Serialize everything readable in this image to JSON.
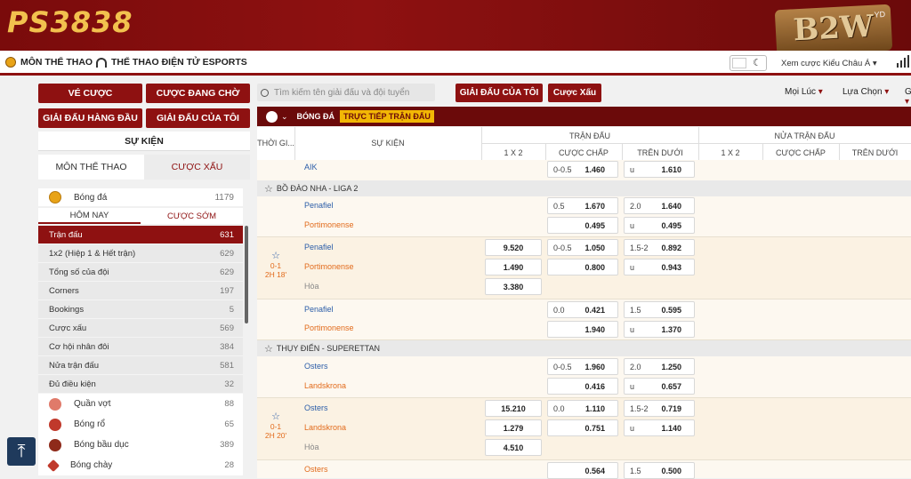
{
  "header": {
    "logo_main": "PS",
    "logo_num": "3838",
    "brand_logo": "B2W",
    "brand_sub": "YD"
  },
  "nav": {
    "sports": "MÔN THỂ THAO",
    "esports": "THỂ THAO ĐIỆN TỬ ESPORTS",
    "odds_format": "Xem cược Kiểu Châu Á",
    "icons": {
      "sports": "soccer-ball-icon",
      "esports": "headset-icon",
      "theme": "moon-icon",
      "signal": "signal-icon"
    }
  },
  "sidebar": {
    "buttons": [
      "VÉ CƯỢC",
      "CƯỢC ĐANG CHỜ",
      "GIẢI ĐẤU HÀNG ĐẦU",
      "GIẢI ĐẤU CỦA TÔI"
    ],
    "events_label": "SỰ KIỆN",
    "tabs": [
      "MÔN THỂ THAO",
      "CƯỢC XẤU"
    ],
    "main_sport": {
      "name": "Bóng đá",
      "count": "1179"
    },
    "subtabs": [
      "HÔM NAY",
      "CƯỢC SỚM"
    ],
    "categories": [
      {
        "label": "Trận đấu",
        "count": "631"
      },
      {
        "label": "1x2 (Hiệp 1 & Hết trận)",
        "count": "629"
      },
      {
        "label": "Tổng số của đội",
        "count": "629"
      },
      {
        "label": "Corners",
        "count": "197"
      },
      {
        "label": "Bookings",
        "count": "5"
      },
      {
        "label": "Cược xấu",
        "count": "569"
      },
      {
        "label": "Cơ hội nhân đôi",
        "count": "384"
      },
      {
        "label": "Nửa trận đấu",
        "count": "581"
      },
      {
        "label": "Đủ điều kiện",
        "count": "32"
      }
    ],
    "sports": [
      {
        "name": "Quần vợt",
        "count": "88",
        "icon": "tennis-icon",
        "color": "#e07a6a"
      },
      {
        "name": "Bóng rổ",
        "count": "65",
        "icon": "basketball-icon",
        "color": "#c0392b"
      },
      {
        "name": "Bóng bầu dục",
        "count": "389",
        "icon": "football-icon",
        "color": "#8e2a1a"
      },
      {
        "name": "Bóng chày",
        "count": "28",
        "icon": "baseball-icon",
        "color": "#c0392b"
      }
    ]
  },
  "toolbar": {
    "search_placeholder": "Tìm kiếm tên giải đấu và đội tuyển",
    "my_leagues": "GIẢI ĐẤU CỦA TÔI",
    "bad_bets": "Cược Xấu",
    "time_filter": "Mọi Lúc",
    "options": "Lựa Chọn",
    "extra": "G"
  },
  "band": {
    "sport": "BÓNG ĐÁ",
    "live": "TRỰC TIẾP TRẬN ĐẤU"
  },
  "table_head": {
    "time": "THỜI GI...",
    "event": "SỰ KIỆN",
    "full": "TRẬN ĐẤU",
    "half": "NỬA TRẬN ĐẤU",
    "x12": "1 X 2",
    "handicap": "CƯỢC CHẤP",
    "overunder": "TRÊN DƯỚI"
  },
  "rows": {
    "aik": {
      "team": "AIK",
      "hdp_line": "0-0.5",
      "hdp_val": "1.460",
      "ou_line": "u",
      "ou_val": "1.610"
    },
    "league1": "BỒ ĐÀO NHA - LIGA 2",
    "m1": {
      "home": "Penafiel",
      "away": "Portimonense",
      "hdp1_line": "0.5",
      "hdp1_val": "1.670",
      "ou1_line": "2.0",
      "ou1_val": "1.640",
      "hdp2_val": "0.495",
      "ou2_line": "u",
      "ou2_val": "0.495"
    },
    "m2": {
      "home": "Penafiel",
      "away": "Portimonense",
      "draw": "Hòa",
      "score": "0-1",
      "clock": "2H 18'",
      "x1": "9.520",
      "x2": "1.490",
      "x3": "3.380",
      "hdp1_line": "0-0.5",
      "hdp1_val": "1.050",
      "ou1_line": "1.5-2",
      "ou1_val": "0.892",
      "hdp2_val": "0.800",
      "ou2_line": "u",
      "ou2_val": "0.943"
    },
    "m3": {
      "home": "Penafiel",
      "away": "Portimonense",
      "hdp1_line": "0.0",
      "hdp1_val": "0.421",
      "ou1_line": "1.5",
      "ou1_val": "0.595",
      "hdp2_val": "1.940",
      "ou2_line": "u",
      "ou2_val": "1.370"
    },
    "league2": "THỤY ĐIỂN - SUPERETTAN",
    "m4": {
      "home": "Osters",
      "away": "Landskrona",
      "hdp1_line": "0-0.5",
      "hdp1_val": "1.960",
      "ou1_line": "2.0",
      "ou1_val": "1.250",
      "hdp2_val": "0.416",
      "ou2_line": "u",
      "ou2_val": "0.657"
    },
    "m5": {
      "home": "Osters",
      "away": "Landskrona",
      "draw": "Hòa",
      "score": "0-1",
      "clock": "2H 20'",
      "x1": "15.210",
      "x2": "1.279",
      "x3": "4.510",
      "hdp1_line": "0.0",
      "hdp1_val": "1.110",
      "ou1_line": "1.5-2",
      "ou1_val": "0.719",
      "hdp2_val": "0.751",
      "ou2_line": "u",
      "ou2_val": "1.140"
    },
    "m6": {
      "home": "Osters",
      "hdp1_val": "0.564",
      "ou1_line": "1.5",
      "ou1_val": "0.500"
    }
  }
}
